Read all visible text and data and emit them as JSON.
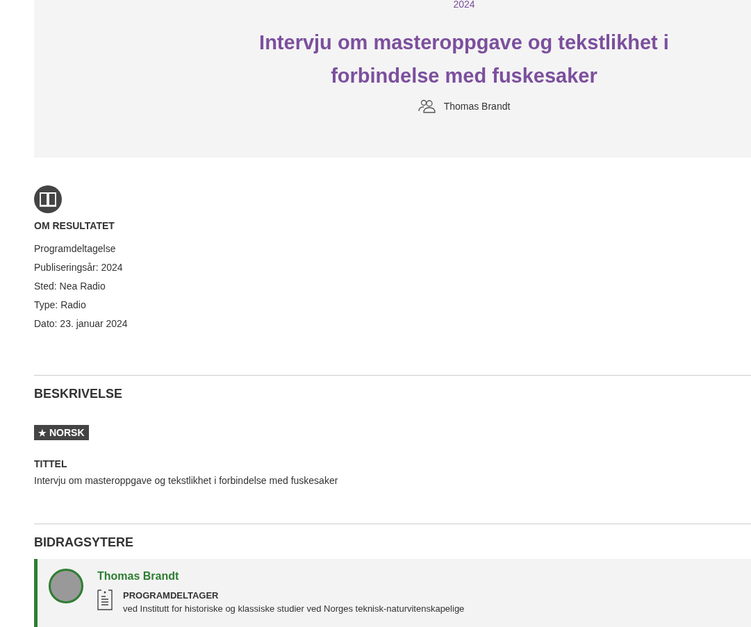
{
  "header": {
    "year": "2024",
    "title": "Intervju om masteroppgave og tekstlikhet i forbindelse med fuskesaker",
    "author": "Thomas Brandt"
  },
  "about": {
    "heading": "OM RESULTATET",
    "lines": [
      "Programdeltagelse",
      "Publiseringsår: 2024",
      "Sted: Nea Radio",
      "Type: Radio",
      "Dato: 23. januar 2024"
    ]
  },
  "description": {
    "heading": "BESKRIVELSE",
    "language_tag": {
      "star": "★",
      "label": "NORSK"
    },
    "field_label": "TITTEL",
    "field_value": "Intervju om masteroppgave og tekstlikhet i forbindelse med fuskesaker"
  },
  "contributors": {
    "heading": "BIDRAGSYTERE",
    "items": [
      {
        "name": "Thomas Brandt",
        "role": "PROGRAMDELTAGER",
        "affiliation": "ved Institutt for historiske og klassiske studier ved Norges teknisk-naturvitenskapelige"
      }
    ]
  }
}
